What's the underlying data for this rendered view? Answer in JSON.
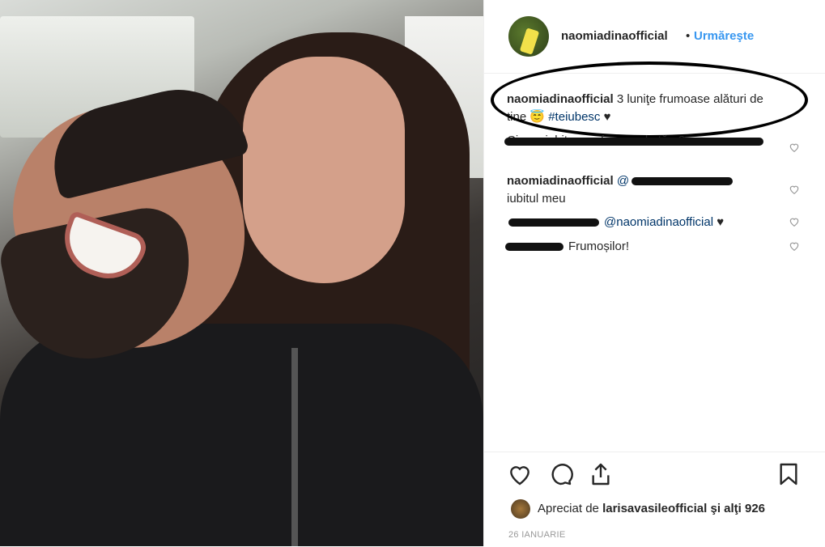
{
  "post": {
    "username": "naomiadinaofficial",
    "dot": "•",
    "follow_label": "Urmăreşte"
  },
  "caption": {
    "username": "naomiadinaofficial",
    "text": "3 luniţe frumoase alături de tine",
    "emoji": "😇",
    "hashtag": "#teiubesc",
    "heart": "♥"
  },
  "comments": [
    {
      "username": "",
      "text": "Cine e iubitu asa frumos de tău ?"
    },
    {
      "username": "naomiadinaofficial",
      "mention_prefix": "@",
      "text": "iubitul meu"
    },
    {
      "username": "",
      "text": "@naomiadinaofficial",
      "heart": "♥"
    },
    {
      "username": "",
      "text": "Frumoșilor!"
    }
  ],
  "likes": {
    "prefix": "Apreciat de",
    "user": "larisavasileofficial",
    "suffix": "şi alţi 926"
  },
  "date": "26 IANUARIE",
  "colors": {
    "follow": "#3897f0",
    "hashtag": "#003569",
    "text": "#262626",
    "muted": "#999999"
  },
  "icons": [
    "heart-icon",
    "comment-icon",
    "share-icon",
    "bookmark-icon"
  ]
}
